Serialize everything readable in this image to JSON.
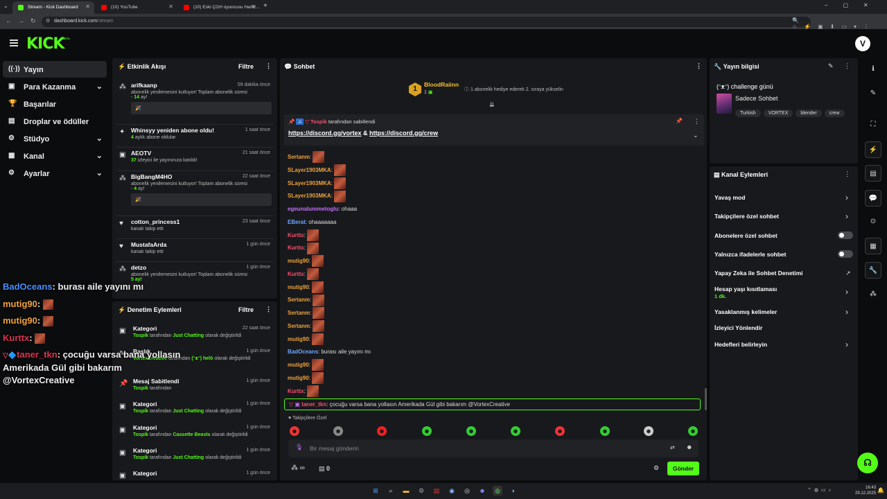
{
  "browser": {
    "tabs": [
      {
        "title": "Stream - Kick Dashboard",
        "color": "#53fc18"
      },
      {
        "title": "(10) YouTube",
        "color": "#ff0000"
      },
      {
        "title": "(10) Eski ÇGH oyuncusu Hamz...",
        "color": "#ff0000"
      }
    ],
    "url_host": "dashboard.kick.com",
    "url_path": "/stream"
  },
  "header": {
    "logo": "KICK",
    "beta": "BETA",
    "avatar_icon": "v-logo-icon"
  },
  "sidebar": {
    "items": [
      {
        "label": "Yayın",
        "icon": "broadcast-icon",
        "chevron": false,
        "active": true
      },
      {
        "label": "Para Kazanma",
        "icon": "money-icon",
        "chevron": true
      },
      {
        "label": "Başarılar",
        "icon": "trophy-icon",
        "chevron": false
      },
      {
        "label": "Droplar ve ödüller",
        "icon": "gift-icon",
        "chevron": false
      },
      {
        "label": "Stüdyo",
        "icon": "gear-icon",
        "chevron": true
      },
      {
        "label": "Kanal",
        "icon": "channel-icon",
        "chevron": true
      },
      {
        "label": "Ayarlar",
        "icon": "settings-icon",
        "chevron": true
      }
    ]
  },
  "activity": {
    "title": "Etkinlik Akışı",
    "filter": "Filtre",
    "events": [
      {
        "name": "arifkaanp",
        "time": "59 dakika önce",
        "line1": "abonelik yenilemesini kutluyor! Toplam abonelik süresi",
        "line2_prefix": "- ",
        "line2_num": "14",
        "line2_suffix": " ay!",
        "bubble": "🎉"
      },
      {
        "name": "Whinsyy yeniden abone oldu!",
        "time": "1 saat önce",
        "line1_num": "4",
        "line1": " aylık abone oldular"
      },
      {
        "name": "AEOTV",
        "time": "21 saat önce",
        "line1_num": "37",
        "line1": " izleyici ile yayınınıza katıldı!"
      },
      {
        "name": "BigBangM4HO",
        "time": "22 saat önce",
        "line1": "abonelik yenilemesini kutluyor! Toplam abonelik süresi",
        "line2_prefix": "- ",
        "line2_num": "4",
        "line2_suffix": " ay!",
        "bubble": "🎉"
      },
      {
        "name": "cotton_princess1",
        "time": "23 saat önce",
        "line1": "kanalı takip etti"
      },
      {
        "name": "MustafaArda",
        "time": "1 gün önce",
        "line1": "kanalı takip etti"
      },
      {
        "name": "detzo",
        "time": "1 gün önce",
        "line1": "abonelik yenilemesini kutluyor! Toplam abonelik süresi",
        "line2_num": "5 ay!"
      }
    ]
  },
  "moderation": {
    "title": "Denetim Eylemleri",
    "filter": "Filtre",
    "items": [
      {
        "title": "Kategori",
        "time": "22 saat önce",
        "user": "Tospik",
        "mid": " tarafından ",
        "val": "Just Chatting",
        "end": " olarak değiştirildi"
      },
      {
        "title": "Başlık",
        "time": "1 gün önce",
        "user": "VortexCreative",
        "mid": " tarafından ",
        "val": "(ᵔᴥᵔ) helö",
        "end": " olarak değiştirildi"
      },
      {
        "title": "Mesaj Sabitlendi",
        "time": "1 gün önce",
        "user": "Tospik",
        "mid": " tarafından",
        "val": "",
        "end": ""
      },
      {
        "title": "Kategori",
        "time": "1 gün önce",
        "user": "Tospik",
        "mid": " tarafından ",
        "val": "Just Chatting",
        "end": " olarak değiştirildi"
      },
      {
        "title": "Kategori",
        "time": "1 gün önce",
        "user": "Tospik",
        "mid": " tarafından ",
        "val": "Cassette Beasts",
        "end": " olarak değiştirildi"
      },
      {
        "title": "Kategori",
        "time": "1 gün önce",
        "user": "Tospik",
        "mid": " tarafından ",
        "val": "Just Chatting",
        "end": " olarak değiştirildi"
      },
      {
        "title": "Kategori",
        "time": "1 gün önce",
        "user": "",
        "mid": "",
        "val": "",
        "end": ""
      }
    ]
  },
  "chat": {
    "title": "Sohbet",
    "gift_user": "BloodRaiinn",
    "gift_rank": "1",
    "gift_count": "1",
    "gift_text": "1 abonelik hediye ederek 2. sıraya yükselin",
    "pinned_by": "Tospik",
    "pinned_label": " tarafından sabitlendi",
    "pinned_link1": "https://discord.gg/vortex",
    "pinned_amp": " & ",
    "pinned_link2": "https://discord.gg/crew",
    "messages": [
      {
        "user": "Sertanm",
        "color": "#f2a33a",
        "text": "",
        "emote": true
      },
      {
        "user": "SLayer1903MKA",
        "color": "#f2a33a",
        "text": "",
        "emote": true
      },
      {
        "user": "SLayer1903MKA",
        "color": "#f2a33a",
        "text": "",
        "emote": true
      },
      {
        "user": "SLayer1903MKA",
        "color": "#f2a33a",
        "text": "",
        "emote": true
      },
      {
        "user": "egeunalummetoglu",
        "color": "#c06ef5",
        "text": "ohaaa",
        "emote": false
      },
      {
        "user": "EBerat",
        "color": "#6da8ff",
        "text": "ohaaaaaaa",
        "emote": false
      },
      {
        "user": "Kurttx",
        "color": "#ff4d6d",
        "text": "",
        "emote": true
      },
      {
        "user": "Kurttx",
        "color": "#ff4d6d",
        "text": "",
        "emote": true
      },
      {
        "user": "mutig90",
        "color": "#f2a33a",
        "text": "",
        "emote": true
      },
      {
        "user": "Kurttx",
        "color": "#ff4d6d",
        "text": "",
        "emote": true
      },
      {
        "user": "mutig90",
        "color": "#f2a33a",
        "text": "",
        "emote": true
      },
      {
        "user": "Sertanm",
        "color": "#f2a33a",
        "text": "",
        "emote": true
      },
      {
        "user": "Sertanm",
        "color": "#f2a33a",
        "text": "",
        "emote": true
      },
      {
        "user": "Sertanm",
        "color": "#f2a33a",
        "text": "",
        "emote": true
      },
      {
        "user": "mutig90",
        "color": "#f2a33a",
        "text": "",
        "emote": true
      },
      {
        "user": "BadOceans",
        "color": "#6da8ff",
        "text": "burası aile yayını mı",
        "emote": false
      },
      {
        "user": "mutig90",
        "color": "#f2a33a",
        "text": "",
        "emote": true
      },
      {
        "user": "mutig90",
        "color": "#f2a33a",
        "text": "",
        "emote": true
      },
      {
        "user": "Kurttx",
        "color": "#ff4d6d",
        "text": "",
        "emote": true
      }
    ],
    "highlight_user": "taner_tkn",
    "highlight_text": "çocuğu varsa bana yollasın Amerikada Gül gibi bakarım @VortexCreative",
    "followers_only": "Takipçilere Özel",
    "input_placeholder": "Bir mesaj gönderin",
    "points": "0",
    "send": "Gönder"
  },
  "overlay": [
    {
      "user": "BadOceans",
      "color": "#4a8cff",
      "text": "burası aile yayını mı"
    },
    {
      "user": "mutig90",
      "color": "#f2a33a",
      "text": ""
    },
    {
      "user": "mutig90",
      "color": "#f2a33a",
      "text": ""
    },
    {
      "user": "Kurttx",
      "color": "#d9344f",
      "text": ""
    },
    {
      "user": "taner_tkn",
      "color": "#d9344f",
      "text": "çocuğu varsa bana yollasın"
    }
  ],
  "overlay_lines": [
    "Amerikada Gül gibi bakarım",
    "@VortexCreative"
  ],
  "stream_info": {
    "title": "Yayın bilgisi",
    "stream_title": "(ᵔᴥᵔ) challenge günü",
    "category": "Sadece Sohbet",
    "tags": [
      "Turkish",
      "VORTEX",
      "blender",
      "crew"
    ]
  },
  "channel_actions": {
    "title": "Kanal Eylemleri",
    "items": [
      {
        "label": "Yavaş mod",
        "kind": "chevron"
      },
      {
        "label": "Takipçilere özel sohbet",
        "kind": "chevron"
      },
      {
        "label": "Abonelere özel sohbet",
        "kind": "toggle"
      },
      {
        "label": "Yalnızca ifadelerle sohbet",
        "kind": "toggle"
      },
      {
        "label": "Yapay Zeka ile Sohbet Denetimi",
        "kind": "external"
      },
      {
        "label": "Hesap yaşı kısıtlaması",
        "kind": "chevron",
        "sub": "1 dk."
      },
      {
        "label": "Yasaklanmış kelimeler",
        "kind": "chevron"
      },
      {
        "label": "İzleyici Yönlendir",
        "kind": "none"
      },
      {
        "label": "Hedefleri belirleyin",
        "kind": "chevron"
      }
    ]
  },
  "taskbar": {
    "time": "16:43",
    "date": "29.12.2025"
  },
  "colors": {
    "accent": "#53fc18",
    "panel": "#18191c",
    "bg": "#0b0c0d"
  }
}
